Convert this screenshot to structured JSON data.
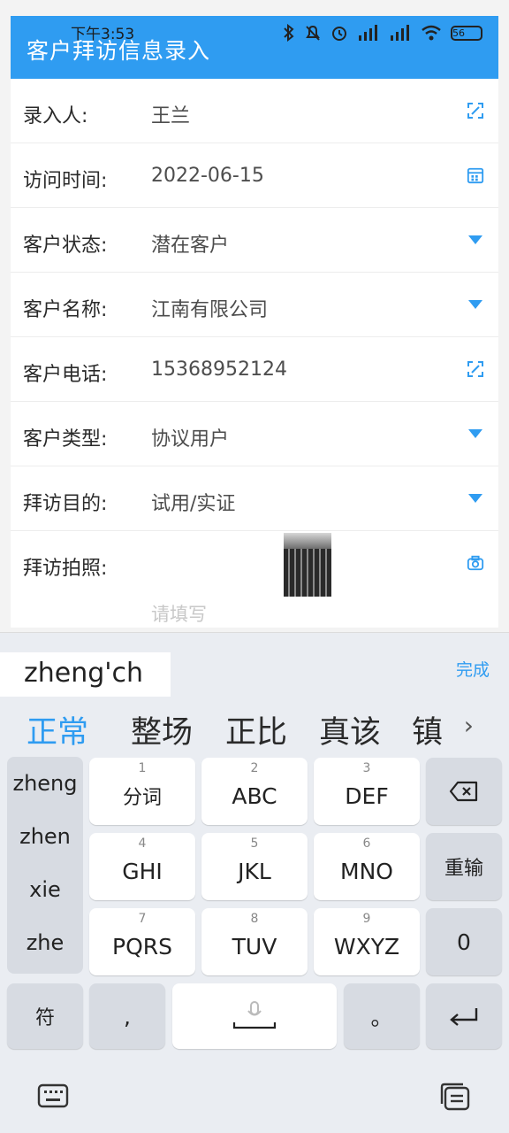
{
  "status_bar": {
    "time": "下午3:53",
    "battery": "56"
  },
  "header": {
    "title": "客户拜访信息录入"
  },
  "form": {
    "rows": [
      {
        "label": "录入人:",
        "value": "王兰",
        "icon": "scan-icon"
      },
      {
        "label": "访问时间:",
        "value": "2022-06-15",
        "icon": "calendar-icon"
      },
      {
        "label": "客户状态:",
        "value": "潜在客户",
        "icon": "dropdown-icon"
      },
      {
        "label": "客户名称:",
        "value": "江南有限公司",
        "icon": "dropdown-icon"
      },
      {
        "label": "客户电话:",
        "value": "15368952124",
        "icon": "scan-icon"
      },
      {
        "label": "客户类型:",
        "value": "协议用户",
        "icon": "dropdown-icon"
      },
      {
        "label": "拜访目的:",
        "value": "试用/实证",
        "icon": "dropdown-icon"
      },
      {
        "label": "拜访拍照:",
        "value": "",
        "icon": "camera-icon"
      }
    ],
    "remark_placeholder": "请填写"
  },
  "keyboard": {
    "pinyin": "zheng'ch",
    "done_label": "完成",
    "candidates": [
      "正常",
      "整场",
      "正比",
      "真该",
      "镇"
    ],
    "syllables": [
      "zheng",
      "zhen",
      "xie",
      "zhe"
    ],
    "keys": [
      {
        "num": "1",
        "label": "分词"
      },
      {
        "num": "2",
        "label": "ABC"
      },
      {
        "num": "3",
        "label": "DEF"
      },
      {
        "num": "4",
        "label": "GHI"
      },
      {
        "num": "5",
        "label": "JKL"
      },
      {
        "num": "6",
        "label": "MNO"
      },
      {
        "num": "7",
        "label": "PQRS"
      },
      {
        "num": "8",
        "label": "TUV"
      },
      {
        "num": "9",
        "label": "WXYZ"
      }
    ],
    "reenter_label": "重输",
    "zero_label": "0",
    "symbol_label": "符",
    "comma_label": ",",
    "period_label": "。"
  }
}
